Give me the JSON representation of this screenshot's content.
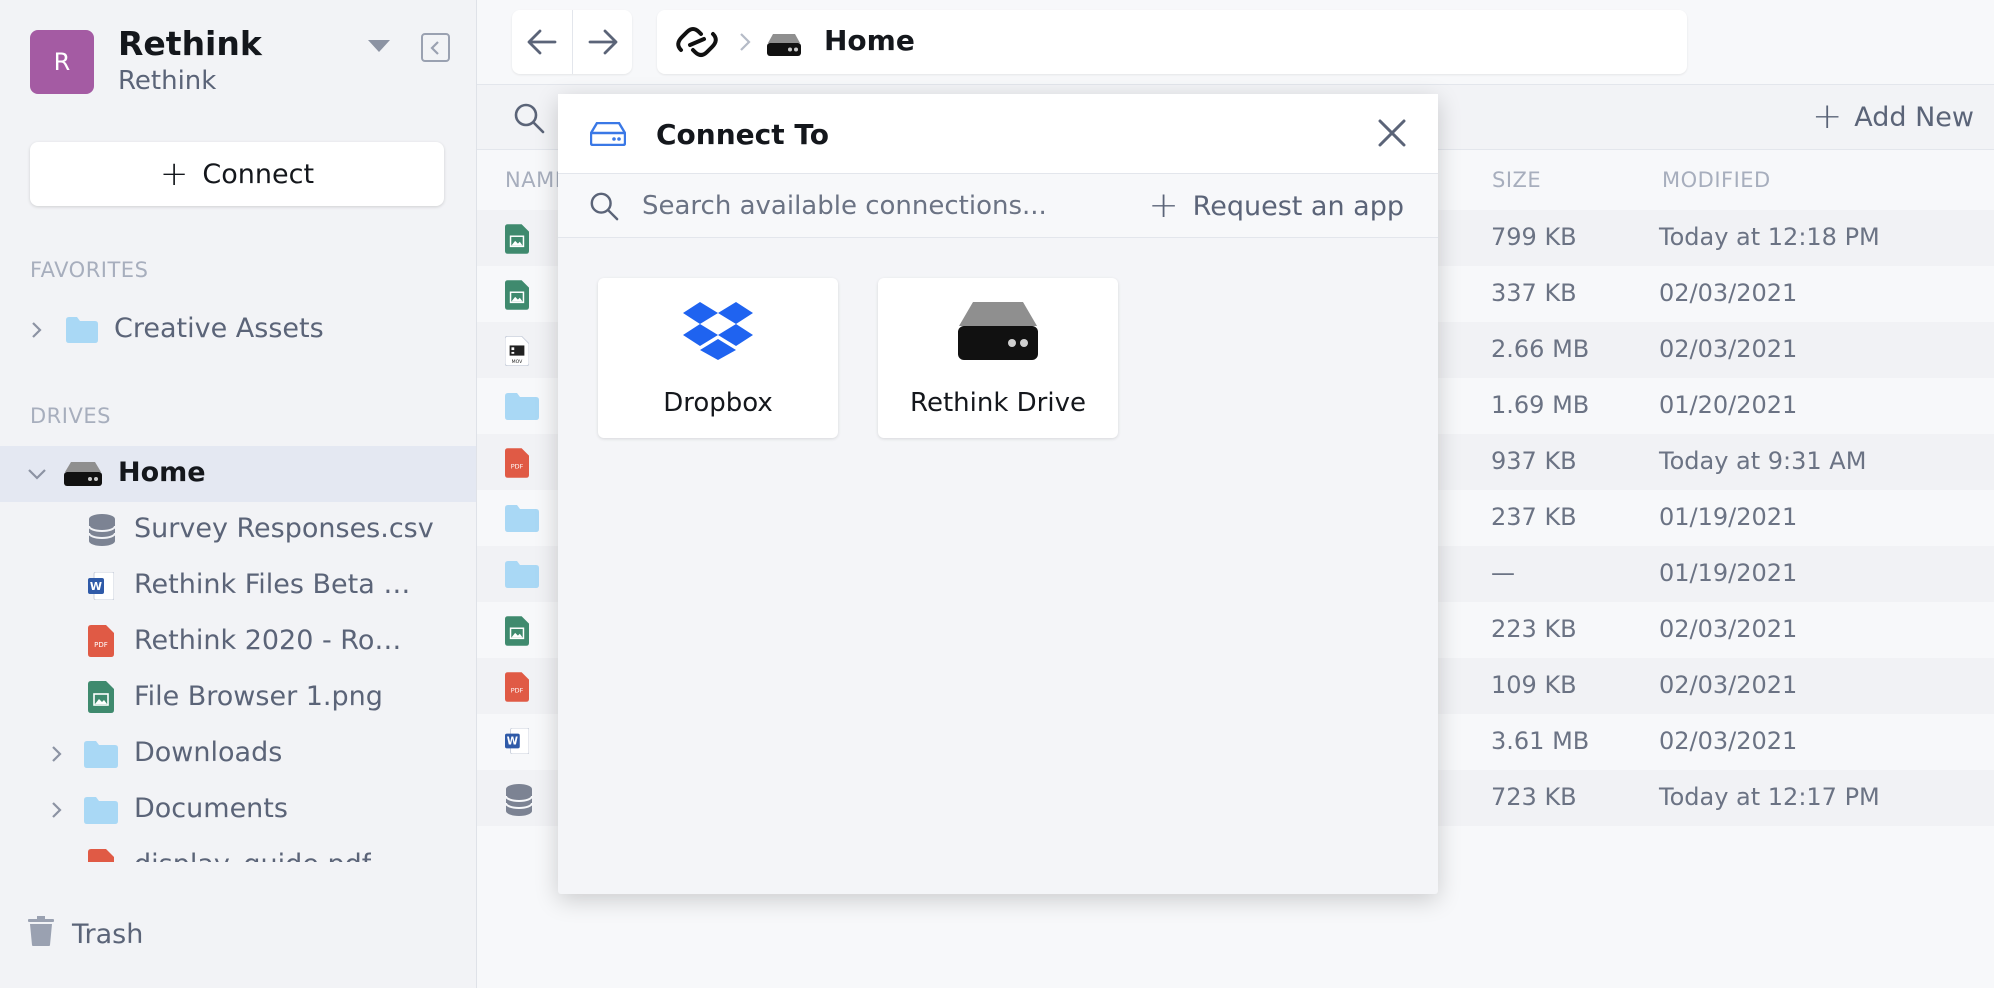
{
  "workspace": {
    "initial": "R",
    "name": "Rethink",
    "subtitle": "Rethink",
    "avatar_color": "#a45ba3"
  },
  "sidebar": {
    "connect_label": "Connect",
    "favorites_label": "FAVORITES",
    "favorites": [
      {
        "label": "Creative Assets",
        "icon": "folder-icon"
      }
    ],
    "drives_label": "DRIVES",
    "drives": [
      {
        "label": "Home",
        "icon": "drive-icon",
        "expanded": true,
        "selected": true
      },
      {
        "label": "Survey Responses.csv",
        "icon": "database-icon"
      },
      {
        "label": "Rethink Files Beta T…",
        "icon": "word-file-icon"
      },
      {
        "label": "Rethink 2020 - Roa…",
        "icon": "pdf-file-icon"
      },
      {
        "label": "File Browser 1.png",
        "icon": "image-file-icon"
      },
      {
        "label": "Downloads",
        "icon": "folder-icon",
        "expanded": false
      },
      {
        "label": "Documents",
        "icon": "folder-icon",
        "expanded": false
      },
      {
        "label": "display_guide.pdf",
        "icon": "pdf-file-icon"
      }
    ],
    "trash_label": "Trash"
  },
  "header": {
    "breadcrumb_title": "Home"
  },
  "toolbar": {
    "add_new_label": "Add New"
  },
  "table": {
    "headers": {
      "name": "NAME",
      "size": "SIZE",
      "modified": "MODIFIED"
    },
    "rows": [
      {
        "icon": "image-file-icon",
        "size": "799 KB",
        "modified": "Today at 12:18 PM"
      },
      {
        "icon": "image-file-icon",
        "size": "337 KB",
        "modified": "02/03/2021"
      },
      {
        "icon": "mov-file-icon",
        "size": "2.66 MB",
        "modified": "02/03/2021"
      },
      {
        "icon": "folder-icon",
        "size": "1.69 MB",
        "modified": "01/20/2021"
      },
      {
        "icon": "pdf-file-icon",
        "size": "937 KB",
        "modified": "Today at 9:31 AM"
      },
      {
        "icon": "folder-icon",
        "size": "237 KB",
        "modified": "01/19/2021"
      },
      {
        "icon": "folder-icon",
        "size": "—",
        "modified": "01/19/2021"
      },
      {
        "icon": "image-file-icon",
        "size": "223 KB",
        "modified": "02/03/2021"
      },
      {
        "icon": "pdf-file-icon",
        "size": "109 KB",
        "modified": "02/03/2021"
      },
      {
        "icon": "word-file-icon",
        "size": "3.61 MB",
        "modified": "02/03/2021"
      },
      {
        "icon": "database-icon",
        "size": "723 KB",
        "modified": "Today at 12:17 PM"
      }
    ]
  },
  "modal": {
    "title": "Connect To",
    "search_placeholder": "Search available connections...",
    "request_label": "Request an app",
    "connections": [
      {
        "label": "Dropbox",
        "icon": "dropbox-icon"
      },
      {
        "label": "Rethink Drive",
        "icon": "rethink-drive-icon"
      }
    ]
  },
  "colors": {
    "accent": "#3a78e6",
    "pdf": "#e05a45",
    "image": "#3f8a6e",
    "folder": "#a9d8f5",
    "word": "#2f5aa8"
  }
}
